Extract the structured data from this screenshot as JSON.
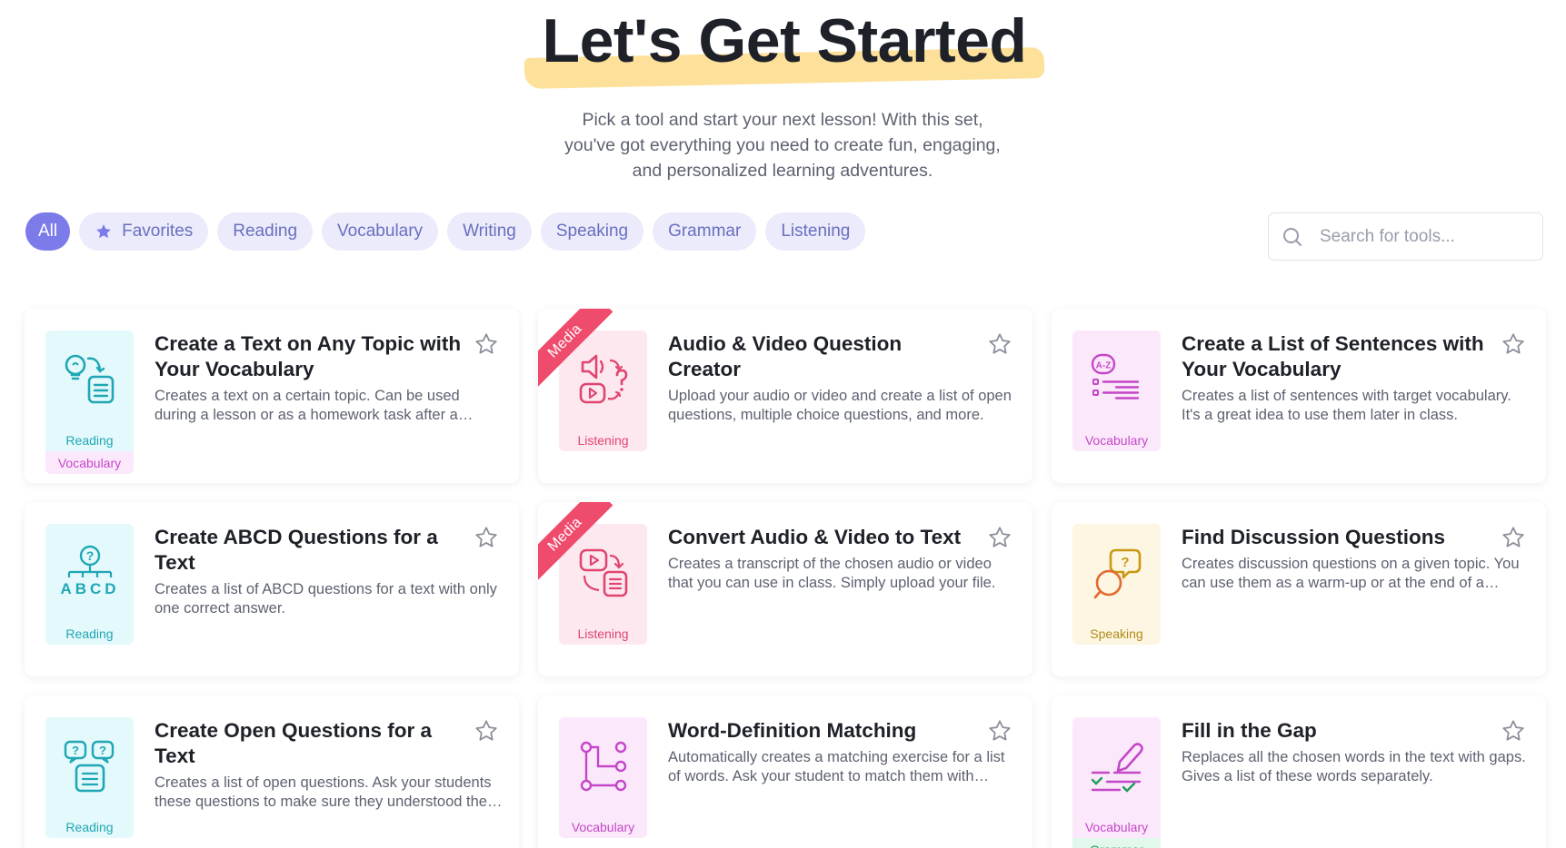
{
  "header": {
    "title": "Let's Get Started",
    "subtitle_lines": [
      "Pick a tool and start your next lesson! With this set,",
      "you've got everything you need to create fun, engaging,",
      "and personalized learning adventures."
    ]
  },
  "filters": [
    {
      "label": "All",
      "active": true
    },
    {
      "label": "Favorites",
      "icon": "star-icon"
    },
    {
      "label": "Reading"
    },
    {
      "label": "Vocabulary"
    },
    {
      "label": "Writing"
    },
    {
      "label": "Speaking"
    },
    {
      "label": "Grammar"
    },
    {
      "label": "Listening"
    }
  ],
  "search": {
    "placeholder": "Search for tools...",
    "icon": "search-icon"
  },
  "colors": {
    "accent": "#7b7bea",
    "chip_bg": "#ebebfb",
    "title_highlight": "#fde19a",
    "media_ribbon": "#ef4b6d"
  },
  "cards": [
    {
      "title": "Create a Text on Any Topic with Your Vocabulary",
      "description": "Creates a text on a certain topic. Can be used during a lesson or as a homework task after a lesson.",
      "tags": [
        "Reading",
        "Vocabulary"
      ],
      "icon": "lightbulb-document-icon"
    },
    {
      "title": "Audio & Video Question Creator",
      "description": "Upload your audio or video and create a list of open questions, multiple choice questions, and more.",
      "tags": [
        "Listening"
      ],
      "ribbon": "Media",
      "icon": "audio-video-question-icon"
    },
    {
      "title": "Create a List of Sentences with Your Vocabulary",
      "description": "Creates a list of sentences with target vocabulary. It's a great idea to use them later in class.",
      "tags": [
        "Vocabulary"
      ],
      "icon": "a-z-list-icon"
    },
    {
      "title": "Create ABCD Questions for a Text",
      "description": "Creates a list of ABCD questions for a text with only one correct answer.",
      "tags": [
        "Reading"
      ],
      "icon": "abcd-question-icon"
    },
    {
      "title": "Convert Audio & Video to Text",
      "description": "Creates a transcript of the chosen audio or video that you can use in class. Simply upload your file.",
      "tags": [
        "Listening"
      ],
      "ribbon": "Media",
      "icon": "video-to-text-icon"
    },
    {
      "title": "Find Discussion Questions",
      "description": "Creates discussion questions on a given topic. You can use them as a warm-up or at the end of a lesson.",
      "tags": [
        "Speaking"
      ],
      "icon": "discussion-bubbles-icon"
    },
    {
      "title": "Create Open Questions for a Text",
      "description": "Creates a list of open questions. Ask your students these questions to make sure they understood the text.",
      "tags": [
        "Reading"
      ],
      "icon": "open-questions-icon"
    },
    {
      "title": "Word-Definition Matching",
      "description": "Automatically creates a matching exercise for a list of words. Ask your student to match them with definitions.",
      "tags": [
        "Vocabulary"
      ],
      "icon": "matching-nodes-icon"
    },
    {
      "title": "Fill in the Gap",
      "description": "Replaces all the chosen words in the text with gaps. Gives a list of these words separately.",
      "tags": [
        "Vocabulary",
        "Grammar"
      ],
      "icon": "pen-checklist-icon"
    }
  ]
}
